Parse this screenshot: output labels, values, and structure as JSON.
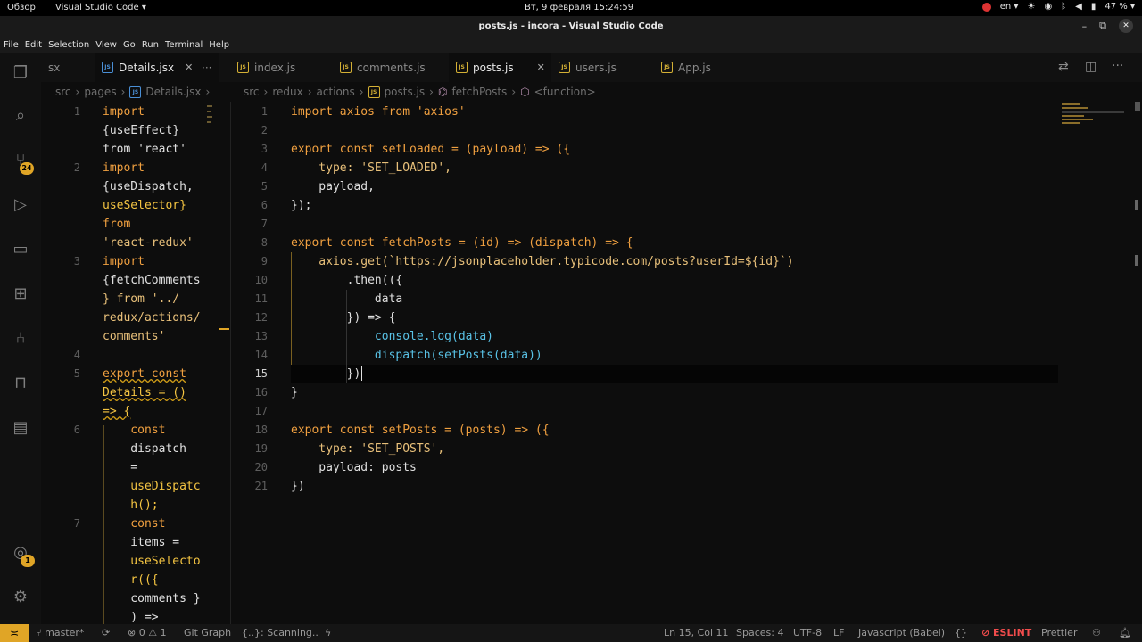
{
  "topbar": {
    "overview": "Обзор",
    "app_menu": "Visual Studio Code ▾",
    "clock": "Вт, 9 февраля  15:24:59",
    "lang": "en ▾",
    "battery": "47 % ▾"
  },
  "window": {
    "title": "posts.js - incora - Visual Studio Code"
  },
  "menu": [
    "File",
    "Edit",
    "Selection",
    "View",
    "Go",
    "Run",
    "Terminal",
    "Help"
  ],
  "activity": {
    "scm_badge": "24",
    "accounts_badge": "1"
  },
  "tabs_left": {
    "fragment": "sx",
    "active": "Details.jsx",
    "more": "···"
  },
  "tabs_right": [
    "index.js",
    "comments.js",
    "posts.js",
    "users.js",
    "App.js"
  ],
  "crumbs_left": [
    "src",
    "pages",
    "Details.jsx"
  ],
  "crumbs_right": [
    "src",
    "redux",
    "actions",
    "posts.js",
    "fetchPosts",
    "<function>"
  ],
  "left_code": {
    "lines": [
      {
        "n": "1",
        "t": "import"
      },
      {
        "n": "",
        "t": "{useEffect}"
      },
      {
        "n": "",
        "t": "from 'react'"
      },
      {
        "n": "2",
        "t": "import"
      },
      {
        "n": "",
        "t": "{useDispatch,"
      },
      {
        "n": "",
        "t": "useSelector}"
      },
      {
        "n": "",
        "t": "from"
      },
      {
        "n": "",
        "t": "'react-redux'"
      },
      {
        "n": "3",
        "t": "import"
      },
      {
        "n": "",
        "t": "{fetchComments"
      },
      {
        "n": "",
        "t": "} from '../"
      },
      {
        "n": "",
        "t": "redux/actions/"
      },
      {
        "n": "",
        "t": "comments'"
      },
      {
        "n": "4",
        "t": ""
      },
      {
        "n": "5",
        "t": "export const"
      },
      {
        "n": "",
        "t": "Details = ()"
      },
      {
        "n": "",
        "t": "=> {"
      },
      {
        "n": "6",
        "t": "    const"
      },
      {
        "n": "",
        "t": "    dispatch"
      },
      {
        "n": "",
        "t": "    ="
      },
      {
        "n": "",
        "t": "    useDispatc"
      },
      {
        "n": "",
        "t": "    h();"
      },
      {
        "n": "7",
        "t": "    const"
      },
      {
        "n": "",
        "t": "    items ="
      },
      {
        "n": "",
        "t": "    useSelecto"
      },
      {
        "n": "",
        "t": "    r(({"
      },
      {
        "n": "",
        "t": "    comments }"
      },
      {
        "n": "",
        "t": "    ) =>"
      }
    ]
  },
  "right_code": {
    "lines": [
      {
        "n": "1",
        "t": "import axios from 'axios'"
      },
      {
        "n": "2",
        "t": ""
      },
      {
        "n": "3",
        "t": "export const setLoaded = (payload) => ({"
      },
      {
        "n": "4",
        "t": "    type: 'SET_LOADED',"
      },
      {
        "n": "5",
        "t": "    payload,"
      },
      {
        "n": "6",
        "t": "});"
      },
      {
        "n": "7",
        "t": ""
      },
      {
        "n": "8",
        "t": "export const fetchPosts = (id) => (dispatch) => {"
      },
      {
        "n": "9",
        "t": "    axios.get(`https://jsonplaceholder.typicode.com/posts?userId=${id}`)"
      },
      {
        "n": "10",
        "t": "        .then(({"
      },
      {
        "n": "11",
        "t": "            data"
      },
      {
        "n": "12",
        "t": "        }) => {"
      },
      {
        "n": "13",
        "t": "            console.log(data)"
      },
      {
        "n": "14",
        "t": "            dispatch(setPosts(data))"
      },
      {
        "n": "15",
        "t": "        })"
      },
      {
        "n": "16",
        "t": "}"
      },
      {
        "n": "17",
        "t": ""
      },
      {
        "n": "18",
        "t": "export const setPosts = (posts) => ({"
      },
      {
        "n": "19",
        "t": "    type: 'SET_POSTS',"
      },
      {
        "n": "20",
        "t": "    payload: posts"
      },
      {
        "n": "21",
        "t": "})"
      }
    ]
  },
  "status": {
    "branch": "master*",
    "problems": "⊗ 0 ⚠ 1",
    "gitgraph": "Git Graph",
    "scanning": "{..}: Scanning..",
    "position": "Ln 15, Col 11",
    "spaces": "Spaces: 4",
    "encoding": "UTF-8",
    "eol": "LF",
    "language": "Javascript (Babel)",
    "eslint": "ESLINT",
    "prettier": "Prettier"
  },
  "colors": {
    "accent": "#e0a526",
    "keyword": "#f0a040",
    "string": "#e8c07a"
  }
}
